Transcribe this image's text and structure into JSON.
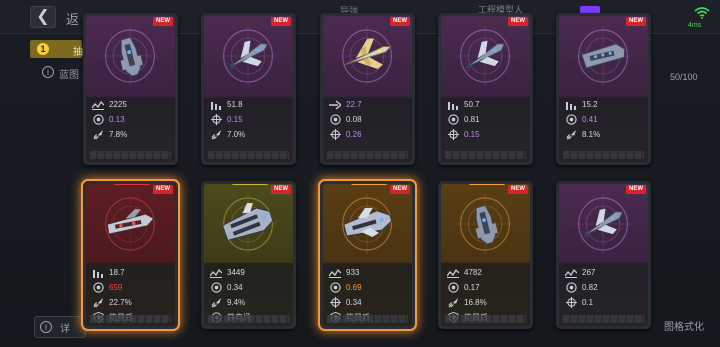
{
  "header": {
    "title": "返",
    "mid_label": "导弹",
    "right_label": "工程模型人",
    "wifi_label": "4ms"
  },
  "tab": {
    "badge": "1",
    "label": "抽"
  },
  "info_label": "蓝图",
  "capacity": "50/100",
  "bottom": {
    "left_label": "详",
    "right_label": "图格式化"
  },
  "new_label": "NEW",
  "colors": {
    "purple": "#b98cf2",
    "red": "#f0474a",
    "orange": "#f29a3a",
    "new_badge": "#d6252a",
    "glow": "#f29a3a"
  },
  "cards": [
    {
      "theme": "purple",
      "glow": false,
      "rarity": "",
      "ship": "cruiser-vertical",
      "stats": [
        {
          "icon": "wave-icon",
          "value": "2225",
          "color": "white"
        },
        {
          "icon": "target-icon",
          "value": "0.13",
          "color": "purple"
        },
        {
          "icon": "missile-icon",
          "value": "7.8%",
          "color": "white"
        }
      ]
    },
    {
      "theme": "purple",
      "glow": false,
      "rarity": "",
      "ship": "fighter-diagonal",
      "stats": [
        {
          "icon": "bars-icon",
          "value": "51.8",
          "color": "white"
        },
        {
          "icon": "crosshair-icon",
          "value": "0.15",
          "color": "purple"
        },
        {
          "icon": "missile-icon",
          "value": "7.0%",
          "color": "white"
        }
      ]
    },
    {
      "theme": "purple",
      "glow": false,
      "rarity": "",
      "ship": "fighter-gold",
      "stats": [
        {
          "icon": "arrow-icon",
          "value": "22.7",
          "color": "purple"
        },
        {
          "icon": "target-icon",
          "value": "0.08",
          "color": "white"
        },
        {
          "icon": "crosshair-icon",
          "value": "0.26",
          "color": "purple"
        }
      ]
    },
    {
      "theme": "purple",
      "glow": false,
      "rarity": "",
      "ship": "fighter-diagonal",
      "stats": [
        {
          "icon": "bars-icon",
          "value": "50.7",
          "color": "white"
        },
        {
          "icon": "target-icon",
          "value": "0.81",
          "color": "white"
        },
        {
          "icon": "crosshair-icon",
          "value": "0.15",
          "color": "purple"
        }
      ]
    },
    {
      "theme": "purple",
      "glow": false,
      "rarity": "",
      "ship": "frigate-flat",
      "stats": [
        {
          "icon": "bars-icon",
          "value": "15.2",
          "color": "white"
        },
        {
          "icon": "target-icon",
          "value": "0.41",
          "color": "purple"
        },
        {
          "icon": "missile-icon",
          "value": "8.1%",
          "color": "white"
        }
      ]
    },
    {
      "theme": "red",
      "glow": true,
      "rarity": "#e0333a",
      "ship": "destroyer-red",
      "stats": [
        {
          "icon": "bars-icon",
          "value": "18.7",
          "color": "white"
        },
        {
          "icon": "target-icon",
          "value": "659",
          "color": "red"
        },
        {
          "icon": "missile-icon",
          "value": "22.7%",
          "color": "white"
        },
        {
          "icon": "shield-icon",
          "value": "能量盾",
          "color": "white"
        }
      ]
    },
    {
      "theme": "olive",
      "glow": false,
      "rarity": "#c9b830",
      "ship": "carrier-heavy",
      "stats": [
        {
          "icon": "wave-icon",
          "value": "3449",
          "color": "white"
        },
        {
          "icon": "target-icon",
          "value": "0.34",
          "color": "white"
        },
        {
          "icon": "missile-icon",
          "value": "9.4%",
          "color": "white"
        },
        {
          "icon": "static-icon",
          "value": "静电场",
          "color": "white"
        }
      ]
    },
    {
      "theme": "amber",
      "glow": true,
      "rarity": "#f2a03a",
      "ship": "battleship-amber",
      "stats": [
        {
          "icon": "wave-icon",
          "value": "933",
          "color": "white"
        },
        {
          "icon": "target-icon",
          "value": "0.69",
          "color": "orange"
        },
        {
          "icon": "crosshair-icon",
          "value": "0.34",
          "color": "white"
        },
        {
          "icon": "shield-icon",
          "value": "能量盾",
          "color": "white"
        }
      ]
    },
    {
      "theme": "amber",
      "glow": false,
      "rarity": "#f2a03a",
      "ship": "cruiser-vertical",
      "stats": [
        {
          "icon": "wave-icon",
          "value": "4782",
          "color": "white"
        },
        {
          "icon": "target-icon",
          "value": "0.17",
          "color": "white"
        },
        {
          "icon": "missile-icon",
          "value": "16.8%",
          "color": "white"
        },
        {
          "icon": "shield-icon",
          "value": "能量盾",
          "color": "white"
        }
      ]
    },
    {
      "theme": "purple",
      "glow": false,
      "rarity": "",
      "ship": "fighter-diagonal",
      "stats": [
        {
          "icon": "wave-icon",
          "value": "267",
          "color": "white"
        },
        {
          "icon": "target-icon",
          "value": "0.82",
          "color": "white"
        },
        {
          "icon": "crosshair-icon",
          "value": "0.1",
          "color": "white"
        }
      ]
    }
  ]
}
